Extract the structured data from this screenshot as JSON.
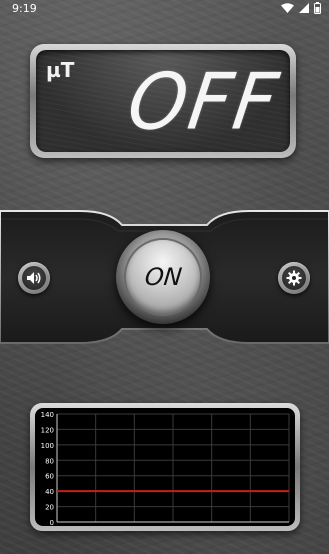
{
  "status_bar": {
    "time": "9:19"
  },
  "display": {
    "unit": "µT",
    "reading": "OFF"
  },
  "controls": {
    "power_label": "ON",
    "sound_icon": "speaker-icon",
    "settings_icon": "gear-icon"
  },
  "colors": {
    "graph_line": "#c81e1e",
    "background": "#4a4a4a",
    "grid": "#3a3a3a"
  },
  "chart_data": {
    "type": "line",
    "title": "",
    "xlabel": "",
    "ylabel": "",
    "ylim": [
      0,
      140
    ],
    "yticks": [
      0,
      20,
      40,
      60,
      80,
      100,
      120,
      140
    ],
    "series": [
      {
        "values": [
          40,
          40,
          40,
          40,
          40,
          40,
          40,
          40,
          40,
          40
        ]
      }
    ],
    "grid": true
  }
}
